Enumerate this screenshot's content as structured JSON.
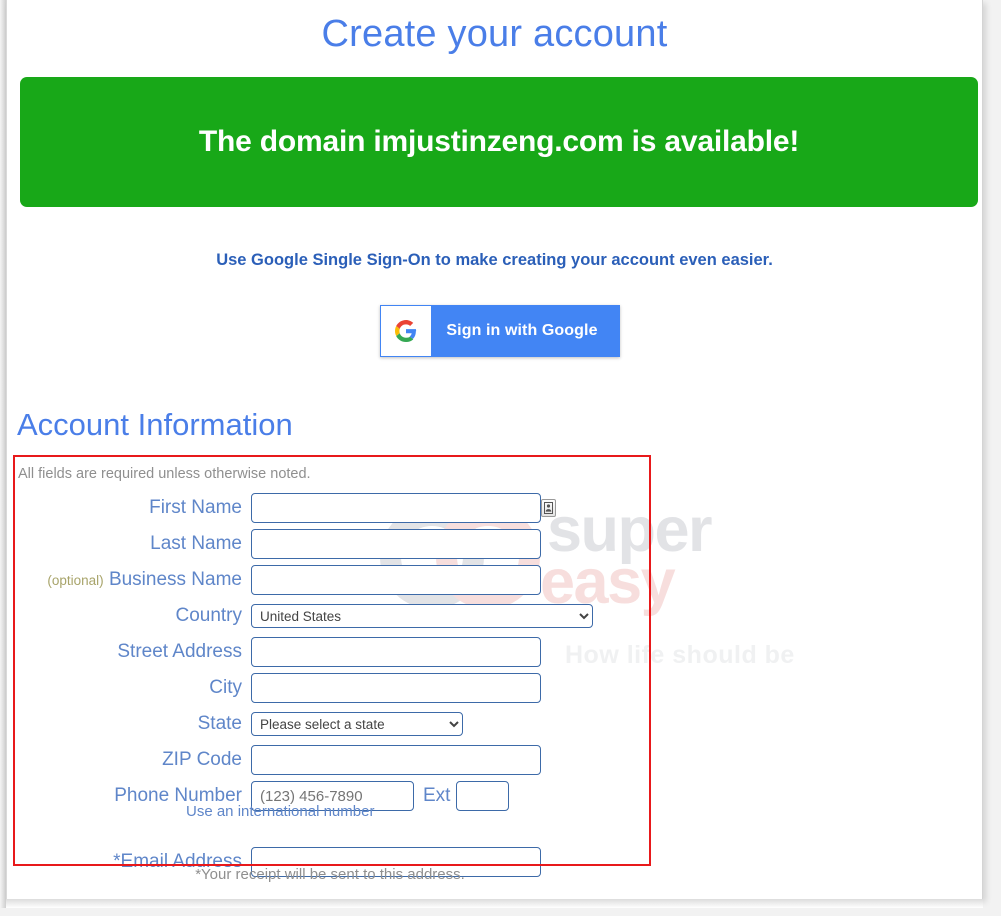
{
  "page": {
    "title": "Create your account"
  },
  "banner": {
    "message": "The domain imjustinzeng.com is available!",
    "color": "#18a818",
    "text_color": "#ffffff"
  },
  "sso": {
    "prompt": "Use Google Single Sign-On to make creating your account even easier.",
    "button_label": "Sign in with Google",
    "button_color": "#4285f4",
    "icon": "google-g-icon"
  },
  "account_section": {
    "heading": "Account Information",
    "required_note": "All fields are required unless otherwise noted.",
    "receipt_note": "*Your receipt will be sent to this address.",
    "international_link": "Use an international number",
    "highlight_color": "#e8191b"
  },
  "fields": {
    "first_name": {
      "label": "First Name",
      "value": "",
      "placeholder": "",
      "icon": "contact-card-icon"
    },
    "last_name": {
      "label": "Last Name",
      "value": "",
      "placeholder": ""
    },
    "business_name": {
      "label": "Business Name",
      "optional_tag": "(optional)",
      "value": "",
      "placeholder": ""
    },
    "country": {
      "label": "Country",
      "selected": "United States",
      "options": [
        "United States"
      ]
    },
    "street_address": {
      "label": "Street Address",
      "value": "",
      "placeholder": ""
    },
    "city": {
      "label": "City",
      "value": "",
      "placeholder": ""
    },
    "state": {
      "label": "State",
      "selected": "Please select a state",
      "options": [
        "Please select a state"
      ]
    },
    "zip_code": {
      "label": "ZIP Code",
      "value": "",
      "placeholder": ""
    },
    "phone_number": {
      "label": "Phone Number",
      "value": "",
      "placeholder": "(123) 456-7890"
    },
    "extension": {
      "label": "Ext",
      "value": "",
      "placeholder": ""
    },
    "email_address": {
      "label": "*Email Address",
      "value": "",
      "placeholder": ""
    }
  },
  "watermark": {
    "word_top": "super",
    "word_bottom": "easy",
    "tagline": "How life should be",
    "gray": "#e2e3e6",
    "pink": "#f7dedd"
  }
}
